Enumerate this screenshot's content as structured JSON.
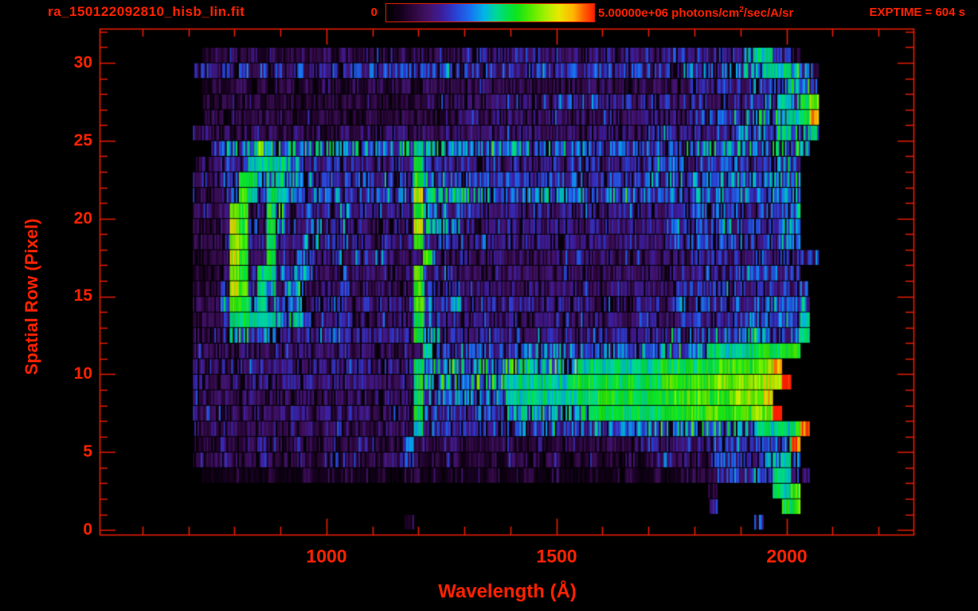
{
  "header": {
    "filename": "ra_150122092810_hisb_lin.fit",
    "colorbar": {
      "min_label": "0",
      "max_label": "5.00000e+06",
      "units_prefix": " photons/cm",
      "units_sup": "2",
      "units_suffix": "/sec/A/sr"
    },
    "exptime": "EXPTIME = 604 s"
  },
  "axes": {
    "x": {
      "title": "Wavelength (Å)",
      "tick_labels": [
        "1000",
        "1500",
        "2000"
      ]
    },
    "y": {
      "title": "Spatial Row (Pixel)",
      "tick_labels": [
        "30",
        "25",
        "20",
        "15",
        "10",
        "5",
        "0"
      ]
    }
  },
  "colors": {
    "annotation_red": "#ff2200",
    "frame_red": "#e81c00",
    "background": "#000000"
  },
  "chart_data": {
    "type": "heatmap",
    "title": "ra_150122092810_hisb_lin.fit",
    "xlabel": "Wavelength (Å)",
    "ylabel": "Spatial Row (Pixel)",
    "x_range_angstrom": [
      507,
      2276
    ],
    "y_range_rows": [
      -0.3,
      32.2
    ],
    "x_major_ticks": [
      1000,
      1500,
      2000
    ],
    "x_minor_step": 100,
    "x_minor_range": [
      600,
      2200
    ],
    "y_major_ticks": [
      0,
      5,
      10,
      15,
      20,
      25,
      30
    ],
    "y_minor_step": 1,
    "y_minor_range": [
      0,
      32
    ],
    "colorbar": {
      "min": 0,
      "max": 5000000,
      "max_label": "5.00000e+06",
      "units": "photons/cm^2/sec/A/sr"
    },
    "exposure_time_s": 604,
    "colormap_stops": [
      [
        0.0,
        [
          0,
          0,
          0
        ]
      ],
      [
        0.07,
        [
          20,
          0,
          28
        ]
      ],
      [
        0.13,
        [
          44,
          8,
          60
        ]
      ],
      [
        0.2,
        [
          66,
          18,
          102
        ]
      ],
      [
        0.27,
        [
          60,
          30,
          158
        ]
      ],
      [
        0.33,
        [
          43,
          63,
          209
        ]
      ],
      [
        0.4,
        [
          26,
          110,
          240
        ]
      ],
      [
        0.47,
        [
          0,
          180,
          232
        ]
      ],
      [
        0.53,
        [
          0,
          216,
          150
        ]
      ],
      [
        0.58,
        [
          0,
          224,
          80
        ]
      ],
      [
        0.63,
        [
          16,
          228,
          24
        ]
      ],
      [
        0.7,
        [
          88,
          236,
          0
        ]
      ],
      [
        0.77,
        [
          168,
          240,
          0
        ]
      ],
      [
        0.83,
        [
          232,
          232,
          0
        ]
      ],
      [
        0.9,
        [
          255,
          180,
          0
        ]
      ],
      [
        0.95,
        [
          255,
          96,
          0
        ]
      ],
      [
        1.0,
        [
          255,
          30,
          0
        ]
      ]
    ],
    "image": {
      "wavelength_start": 670,
      "wavelength_step": 20,
      "columns": 70,
      "rows": 32,
      "row0_at_bottom": true,
      "encoding": "hex digit per cell, 0=blank .. f=colorbar max",
      "grid": [
        "0000000000000000000000000100000000000000000000000000000000000004000000",
        "0000000000000000000000000000000000000000000000000000000000500000009a",
        "0000000000000000000000000000000000000000000000000000000000200000088a",
        "0001112111211121112111211121112111211121121112111211211222245456588 53",
        "0022232223222322232232223421222122212212221222122212242222444444558 6",
        "0022232223222322232232223522223222232223222322232233333333344444456e",
        "0032333233323332333232333284444444444555555555555566666667777778888 9e",
        "0033333333333333333333333395555555557777777779999999999aaaaaaaabbf",
        "003333333333333333333333339666666666888888888999999999aaaaaabbbbd",
        "00333333333333333333333333977777777788888889999999999aaaaabbbbbbccf",
        "003333333333333333333333339666666666777777778888888899999 99aaaaabe",
        "0033333333333333334333333338555555555566666666666677777777888889999a",
        "0022235644433333343333333395533333333333333333333333334444444455555 68",
        "0022248988877643334333333395444333333333333333333333334444444455555 68",
        "002226a9585565333343333333a64453333333333333333333333344444444444444 5",
        "002224ca487366333343333333a54453333333333333333333333344444444444444 5",
        "002223b9488446633353333333a54543333333333333333333333344444445555555",
        "002223c93393355344444443333a43343333333333333333333333344444444444444 5",
        "002223ba339533553343333333a44443333333333333333333333344444444444455",
        "002223ca439633553353333333c66665333333333333333333333344444444444455",
        "002223ba339733433353333333a55543333333333333333333333344444444444445",
        "0022235a84885444444444444 4c6666655555555555555555555555555555555555 6",
        "00233449956865444444444444a54444444444444444444444455555555555555556",
        "00233444888876444444444444955444444444444444444444455555555555555665",
        "0000455557765555555555555585555555555555544444444444444555555555566 56",
        "00232322323223232232333333333333333333333333333333344444444446666787 67",
        "0002222222222222222222222222222333333333333333333333333355555557777 89d",
        "000222222222222222222222222333333333333334444444444444444444444467879bb",
        "0001212212122121221212212212222222222222222222222222222233333334445654",
        "00343434343434343434444444444444444444444444444444444444555555568887 53",
        "0002323232323232323232323232323434343434343434343434343434444468864 20",
        "0000000000000000000000000000000000000000000000000000000000000000000000"
      ]
    }
  }
}
